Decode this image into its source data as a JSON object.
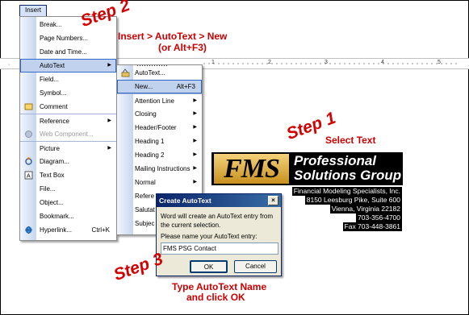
{
  "menubar": {
    "insert": "Insert"
  },
  "ruler": {
    "marks": [
      "1",
      "2",
      "3",
      "4",
      "5"
    ],
    "left_mark": "·"
  },
  "insert_menu": {
    "items": [
      {
        "label": "Break...",
        "icon": ""
      },
      {
        "label": "Page Numbers...",
        "icon": ""
      },
      {
        "label": "Date and Time...",
        "icon": ""
      },
      {
        "label": "AutoText",
        "icon": "",
        "submenu": true,
        "highlighted": true
      },
      {
        "label": "Field...",
        "icon": ""
      },
      {
        "label": "Symbol...",
        "icon": ""
      },
      {
        "label": "Comment",
        "icon": "comment-icon"
      },
      {
        "label": "Reference",
        "icon": "",
        "submenu": true,
        "separator": true
      },
      {
        "label": "Web Component...",
        "icon": "web-component-icon",
        "disabled": true
      },
      {
        "label": "Picture",
        "icon": "",
        "submenu": true,
        "separator": true
      },
      {
        "label": "Diagram...",
        "icon": "diagram-icon"
      },
      {
        "label": "Text Box",
        "icon": "text-box-icon"
      },
      {
        "label": "File...",
        "icon": ""
      },
      {
        "label": "Object...",
        "icon": ""
      },
      {
        "label": "Bookmark...",
        "icon": ""
      },
      {
        "label": "Hyperlink...",
        "icon": "hyperlink-icon",
        "shortcut": "Ctrl+K"
      }
    ]
  },
  "autotext_menu": {
    "items": [
      {
        "label": "AutoText...",
        "icon": "autotext-icon"
      },
      {
        "label": "New...",
        "shortcut": "Alt+F3",
        "highlighted": true
      },
      {
        "label": "Attention Line",
        "submenu": true,
        "separator": true
      },
      {
        "label": "Closing",
        "submenu": true
      },
      {
        "label": "Header/Footer",
        "submenu": true
      },
      {
        "label": "Heading 1",
        "submenu": true
      },
      {
        "label": "Heading 2",
        "submenu": true
      },
      {
        "label": "Mailing Instructions",
        "submenu": true
      },
      {
        "label": "Normal",
        "submenu": true
      },
      {
        "label": "Refere",
        "submenu": false
      },
      {
        "label": "Salutat",
        "submenu": false
      },
      {
        "label": "Subjec",
        "submenu": false
      }
    ]
  },
  "dialog": {
    "title": "Create AutoText",
    "close": "×",
    "message": "Word will create an AutoText entry from the current selection.",
    "prompt": "Please name your AutoText entry:",
    "value": "FMS PSG Contact",
    "ok": "OK",
    "cancel": "Cancel"
  },
  "logo": {
    "fms": "FMS",
    "line1": "Professional",
    "line2": "Solutions Group"
  },
  "contact": [
    "Financial Modeling Specialists, Inc.",
    "8150 Leesburg Pike, Suite 600",
    "Vienna, Virginia 22182",
    "703-356-4700",
    "Fax 703-448-3861"
  ],
  "annotations": {
    "step2": "Step 2",
    "step2_note_a": "Insert > AutoText > New",
    "step2_note_b": "(or Alt+F3)",
    "step1": "Step 1",
    "step1_note": "Select Text",
    "step3": "Step 3",
    "step3_note_a": "Type AutoText Name",
    "step3_note_b": "and click OK"
  },
  "colors": {
    "annotation": "#cc0000",
    "menu_highlight": "#c1d2ee",
    "title_bar": "#0a246a",
    "logo_gold": "#d9a43a"
  }
}
